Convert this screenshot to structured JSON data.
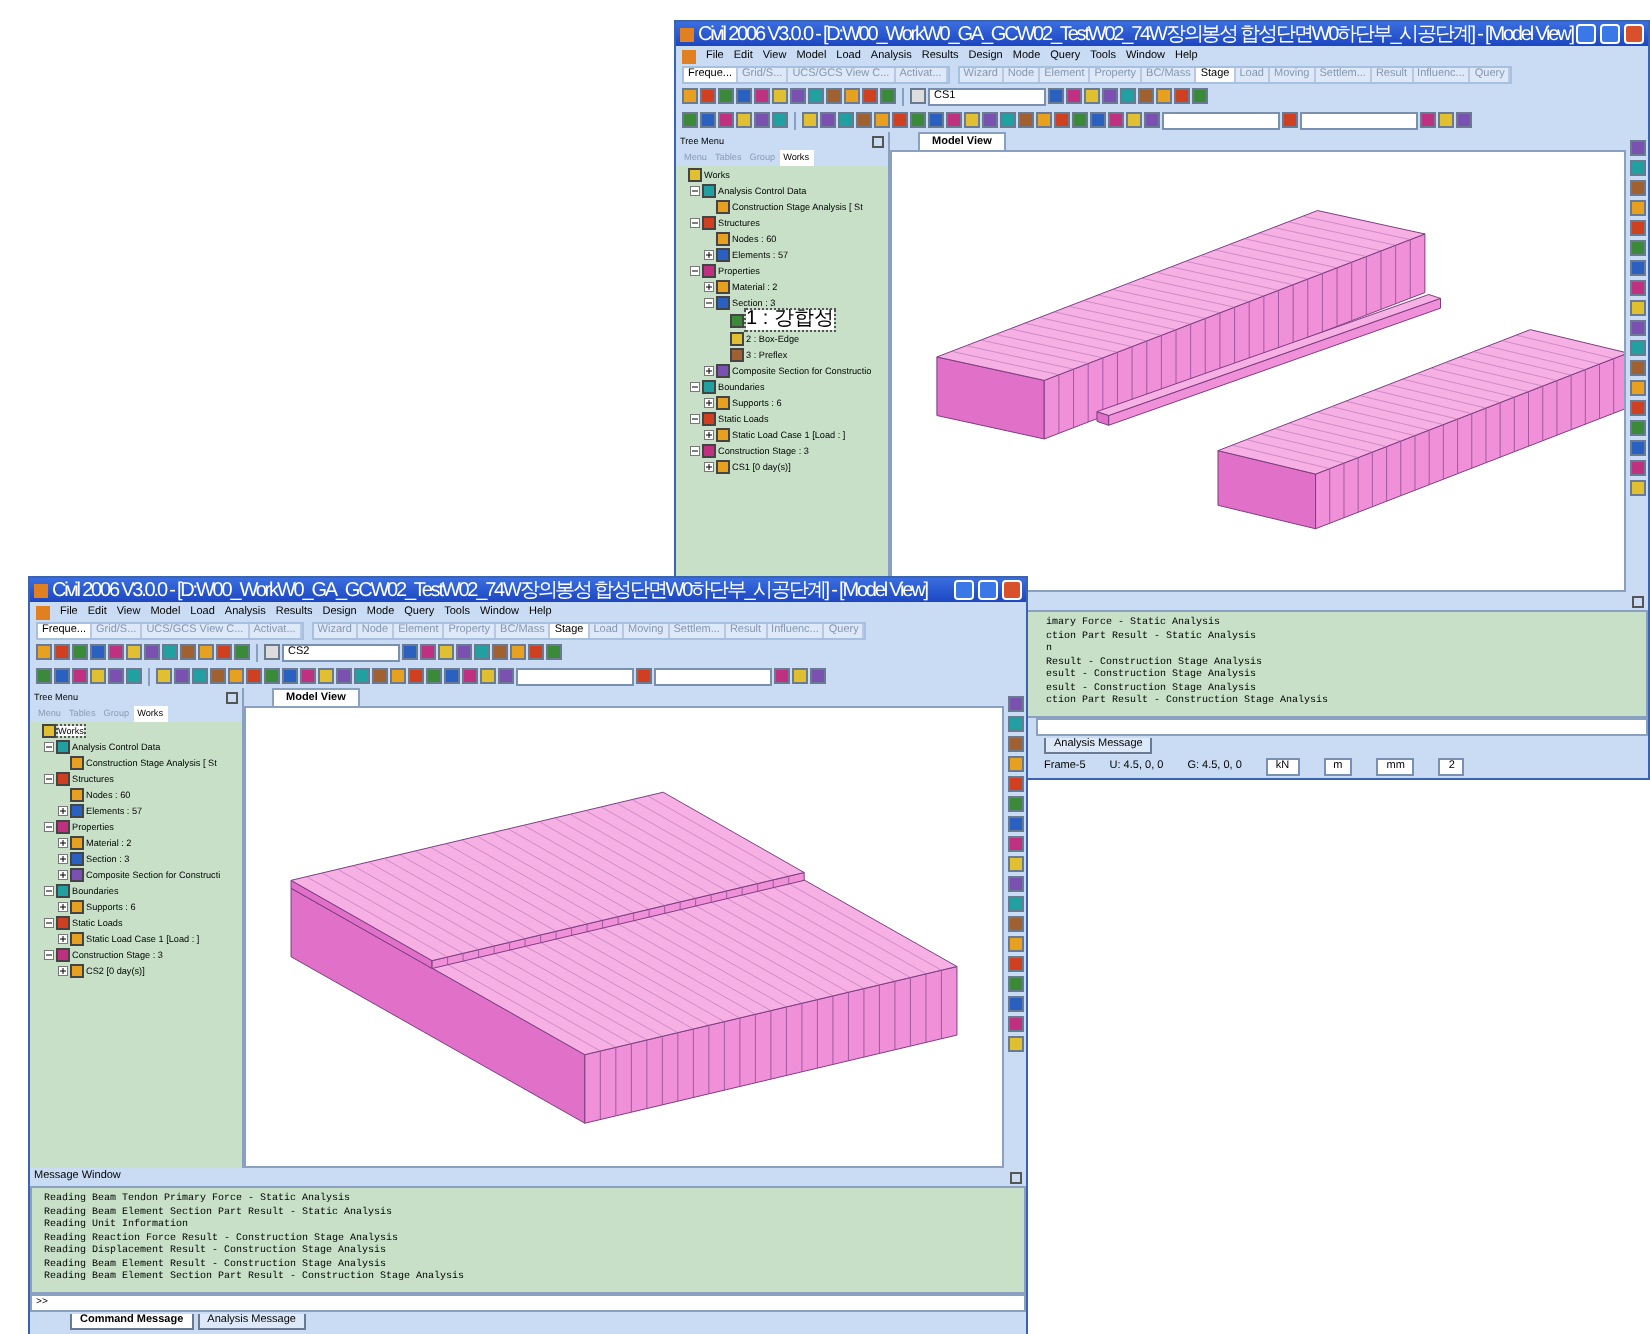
{
  "windows": [
    {
      "title": "Civil 2006 V3.0.0 - [D:W00_WorkW0_GA_GCW02_TestW02_74W장의봉성 합성단면W0하단부_시공단계] - [Model View]",
      "menu": [
        "File",
        "Edit",
        "View",
        "Model",
        "Load",
        "Analysis",
        "Results",
        "Design",
        "Mode",
        "Query",
        "Tools",
        "Window",
        "Help"
      ],
      "toolbar_tabs_left": [
        {
          "label": "Freque...",
          "selected": true
        },
        {
          "label": "Grid/S...",
          "selected": false
        },
        {
          "label": "UCS/GCS View C...",
          "selected": false
        },
        {
          "label": "Activat...",
          "selected": false
        }
      ],
      "toolbar_tabs_right": [
        {
          "label": "Wizard",
          "selected": false
        },
        {
          "label": "Node",
          "selected": false
        },
        {
          "label": "Element",
          "selected": false
        },
        {
          "label": "Property",
          "selected": false
        },
        {
          "label": "BC/Mass",
          "selected": false
        },
        {
          "label": "Stage",
          "selected": true
        },
        {
          "label": "Load",
          "selected": false
        },
        {
          "label": "Moving",
          "selected": false
        },
        {
          "label": "Settlem...",
          "selected": false
        },
        {
          "label": "Result",
          "selected": false
        },
        {
          "label": "Influenc...",
          "selected": false
        },
        {
          "label": "Query",
          "selected": false
        }
      ],
      "stage_combo": "CS1",
      "tree_title": "Tree Menu",
      "tree_tabs": [
        {
          "label": "Menu",
          "selected": false
        },
        {
          "label": "Tables",
          "selected": false
        },
        {
          "label": "Group",
          "selected": false
        },
        {
          "label": "Works",
          "selected": true
        }
      ],
      "tree": [
        {
          "label": "Works",
          "selected": false,
          "children": [
            {
              "label": "Analysis Control Data",
              "selected": false,
              "expanded": true,
              "children": [
                {
                  "label": "Construction Stage Analysis [ St",
                  "selected": false
                }
              ]
            },
            {
              "label": "Structures",
              "selected": false,
              "expanded": true,
              "children": [
                {
                  "label": "Nodes : 60",
                  "selected": false
                },
                {
                  "label": "Elements : 57",
                  "selected": false,
                  "expanded": false
                }
              ]
            },
            {
              "label": "Properties",
              "selected": false,
              "expanded": true,
              "children": [
                {
                  "label": "Material : 2",
                  "selected": false,
                  "expanded": false
                },
                {
                  "label": "Section : 3",
                  "selected": false,
                  "expanded": true,
                  "children": [
                    {
                      "label": "1 : 강합성",
                      "selected": true
                    },
                    {
                      "label": "2 : Box-Edge",
                      "selected": false
                    },
                    {
                      "label": "3 : Preflex",
                      "selected": false
                    }
                  ]
                },
                {
                  "label": "Composite Section for Constructio",
                  "selected": false,
                  "expanded": false
                }
              ]
            },
            {
              "label": "Boundaries",
              "selected": false,
              "expanded": true,
              "children": [
                {
                  "label": "Supports : 6",
                  "selected": false,
                  "expanded": false
                }
              ]
            },
            {
              "label": "Static Loads",
              "selected": false,
              "expanded": true,
              "children": [
                {
                  "label": "Static Load Case 1 [Load : ]",
                  "selected": false,
                  "expanded": false
                }
              ]
            },
            {
              "label": "Construction Stage : 3",
              "selected": false,
              "expanded": true,
              "children": [
                {
                  "label": "CS1 [0 day(s)]",
                  "selected": false,
                  "expanded": false
                }
              ]
            }
          ]
        }
      ],
      "view_tab": "Model View",
      "model": {
        "kind": "girders"
      },
      "messages": [
        "imary Force - Static Analysis",
        "ction Part Result - Static Analysis",
        "n",
        "Result - Construction Stage Analysis",
        "esult - Construction Stage Analysis",
        "esult - Construction Stage Analysis",
        "ction Part Result - Construction Stage Analysis"
      ],
      "message_tabs": [
        {
          "label": "Analysis Message",
          "selected": false
        }
      ],
      "status": [
        "Frame-5",
        "U: 4.5, 0, 0",
        "G: 4.5, 0, 0"
      ],
      "status_controls": [
        "kN",
        "m",
        "mm",
        "2"
      ]
    },
    {
      "title": "Civil 2006 V3.0.0 - [D:W00_WorkW0_GA_GCW02_TestW02_74W장의봉성 합성단면W0하단부_시공단계] - [Model View]",
      "menu": [
        "File",
        "Edit",
        "View",
        "Model",
        "Load",
        "Analysis",
        "Results",
        "Design",
        "Mode",
        "Query",
        "Tools",
        "Window",
        "Help"
      ],
      "toolbar_tabs_left": [
        {
          "label": "Freque...",
          "selected": true
        },
        {
          "label": "Grid/S...",
          "selected": false
        },
        {
          "label": "UCS/GCS View C...",
          "selected": false
        },
        {
          "label": "Activat...",
          "selected": false
        }
      ],
      "toolbar_tabs_right": [
        {
          "label": "Wizard",
          "selected": false
        },
        {
          "label": "Node",
          "selected": false
        },
        {
          "label": "Element",
          "selected": false
        },
        {
          "label": "Property",
          "selected": false
        },
        {
          "label": "BC/Mass",
          "selected": false
        },
        {
          "label": "Stage",
          "selected": true
        },
        {
          "label": "Load",
          "selected": false
        },
        {
          "label": "Moving",
          "selected": false
        },
        {
          "label": "Settlem...",
          "selected": false
        },
        {
          "label": "Result",
          "selected": false
        },
        {
          "label": "Influenc...",
          "selected": false
        },
        {
          "label": "Query",
          "selected": false
        }
      ],
      "stage_combo": "CS2",
      "tree_title": "Tree Menu",
      "tree_tabs": [
        {
          "label": "Menu",
          "selected": false
        },
        {
          "label": "Tables",
          "selected": false
        },
        {
          "label": "Group",
          "selected": false
        },
        {
          "label": "Works",
          "selected": true
        }
      ],
      "tree": [
        {
          "label": "Works",
          "selected": true,
          "children": [
            {
              "label": "Analysis Control Data",
              "selected": false,
              "expanded": true,
              "children": [
                {
                  "label": "Construction Stage Analysis [ St",
                  "selected": false
                }
              ]
            },
            {
              "label": "Structures",
              "selected": false,
              "expanded": true,
              "children": [
                {
                  "label": "Nodes : 60",
                  "selected": false
                },
                {
                  "label": "Elements : 57",
                  "selected": false,
                  "expanded": false
                }
              ]
            },
            {
              "label": "Properties",
              "selected": false,
              "expanded": true,
              "children": [
                {
                  "label": "Material : 2",
                  "selected": false,
                  "expanded": false
                },
                {
                  "label": "Section : 3",
                  "selected": false,
                  "expanded": false
                },
                {
                  "label": "Composite Section for Constructi",
                  "selected": false,
                  "expanded": false
                }
              ]
            },
            {
              "label": "Boundaries",
              "selected": false,
              "expanded": true,
              "children": [
                {
                  "label": "Supports : 6",
                  "selected": false,
                  "expanded": false
                }
              ]
            },
            {
              "label": "Static Loads",
              "selected": false,
              "expanded": true,
              "children": [
                {
                  "label": "Static Load Case 1 [Load : ]",
                  "selected": false,
                  "expanded": false
                }
              ]
            },
            {
              "label": "Construction Stage : 3",
              "selected": false,
              "expanded": true,
              "children": [
                {
                  "label": "CS2 [0 day(s)]",
                  "selected": false,
                  "expanded": false
                }
              ]
            }
          ]
        }
      ],
      "view_tab": "Model View",
      "model": {
        "kind": "deck"
      },
      "message_title": "Message Window",
      "messages": [
        "Reading Beam Tendon Primary Force - Static Analysis",
        "Reading Beam Element Section Part Result - Static Analysis",
        "Reading Unit Information",
        "Reading Reaction Force Result - Construction Stage Analysis",
        "Reading Displacement Result - Construction Stage Analysis",
        "Reading Beam Element Result - Construction Stage Analysis",
        "Reading Beam Element Section Part Result - Construction Stage Analysis"
      ],
      "prompt": ">>",
      "message_tabs": [
        {
          "label": "Command Message",
          "selected": true
        },
        {
          "label": "Analysis Message",
          "selected": false
        }
      ]
    }
  ]
}
